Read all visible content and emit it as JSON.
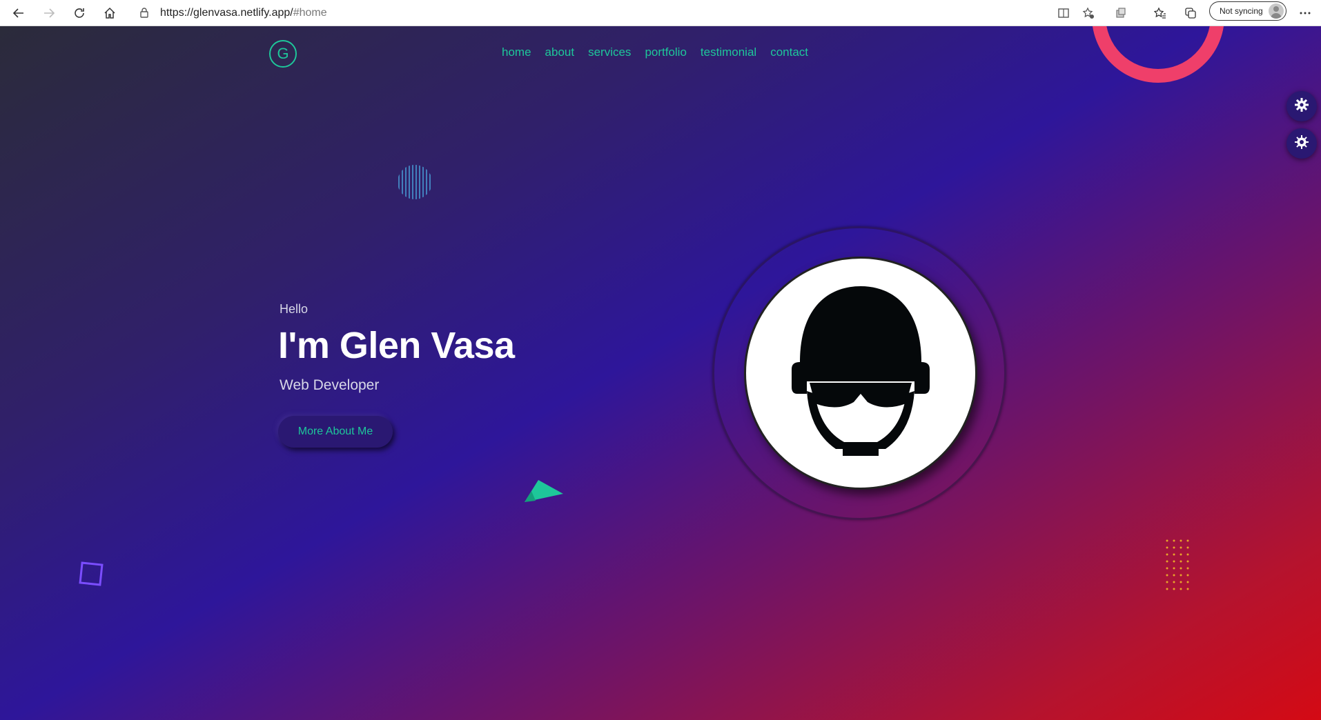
{
  "browser": {
    "url_host": "https://glenvasa.netlify.app/",
    "url_path": "#home",
    "sync_label": "Not syncing",
    "icons": [
      "back-icon",
      "forward-icon",
      "refresh-icon",
      "home-icon",
      "lock-icon",
      "reader-icon",
      "favorite-add-icon",
      "extensions-icon",
      "favorites-icon",
      "collections-icon",
      "more-icon"
    ]
  },
  "site": {
    "logo_letter": "G",
    "nav": [
      "home",
      "about",
      "services",
      "portfolio",
      "testimonial",
      "contact"
    ],
    "hero": {
      "greeting": "Hello",
      "name": "I'm Glen Vasa",
      "role": "Web Developer",
      "cta": "More About Me"
    },
    "side_buttons": [
      "gear-icon",
      "sun-gear-icon"
    ],
    "colors": {
      "accent": "#1ec79a",
      "ring": "#ef3f6a",
      "square": "#7b4dff",
      "dots": "#e8a52a"
    }
  }
}
